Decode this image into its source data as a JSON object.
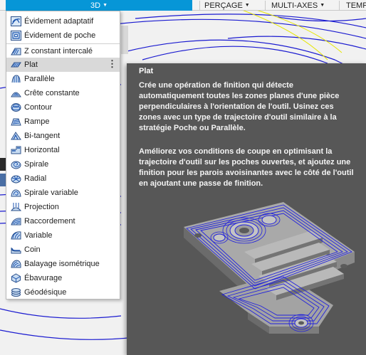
{
  "toolbar": {
    "tab_3d": "3D",
    "percage": "PERÇAGE",
    "multi_axes": "MULTI-AXES",
    "temp": "TEMP"
  },
  "menu": {
    "items": [
      {
        "label": "Évidement adaptatif",
        "icon": "adaptive-clearing-icon"
      },
      {
        "label": "Évidement de poche",
        "icon": "pocket-clearing-icon"
      },
      {
        "label": "Z constant intercalé",
        "icon": "steep-and-shallow-icon"
      },
      {
        "label": "Plat",
        "icon": "flat-icon",
        "selected": true
      },
      {
        "label": "Parallèle",
        "icon": "parallel-icon"
      },
      {
        "label": "Crête constante",
        "icon": "scallop-icon"
      },
      {
        "label": "Contour",
        "icon": "contour-icon"
      },
      {
        "label": "Rampe",
        "icon": "ramp-icon"
      },
      {
        "label": "Bi-tangent",
        "icon": "pencil-icon"
      },
      {
        "label": "Horizontal",
        "icon": "horizontal-icon"
      },
      {
        "label": "Spirale",
        "icon": "spiral-icon"
      },
      {
        "label": "Radial",
        "icon": "radial-icon"
      },
      {
        "label": "Spirale variable",
        "icon": "morphed-spiral-icon"
      },
      {
        "label": "Projection",
        "icon": "project-icon"
      },
      {
        "label": "Raccordement",
        "icon": "blend-icon"
      },
      {
        "label": "Variable",
        "icon": "flow-icon"
      },
      {
        "label": "Coin",
        "icon": "corner-icon"
      },
      {
        "label": "Balayage isométrique",
        "icon": "morph-icon"
      },
      {
        "label": "Ébavurage",
        "icon": "deburr-icon"
      },
      {
        "label": "Géodésique",
        "icon": "geodesic-icon"
      }
    ],
    "more_label": "⋮"
  },
  "tooltip": {
    "title": "Plat",
    "paragraph1": "Crée une opération de finition qui détecte automatiquement toutes les zones planes d'une pièce perpendiculaires à l'orientation de l'outil. Usinez ces zones avec un type de trajectoire d'outil similaire à la stratégie Poche ou Parallèle.",
    "paragraph2": "Améliorez vos conditions de coupe en optimisant la trajectoire d'outil sur les poches ouvertes, et ajoutez une finition pour les parois avoisinantes avec le côté de l'outil en ajoutant une passe de finition."
  },
  "colors": {
    "accent": "#0696d7",
    "tooltip_bg": "#575757",
    "toolpath": "#1a1ad0",
    "part": "#b8b8b8"
  }
}
